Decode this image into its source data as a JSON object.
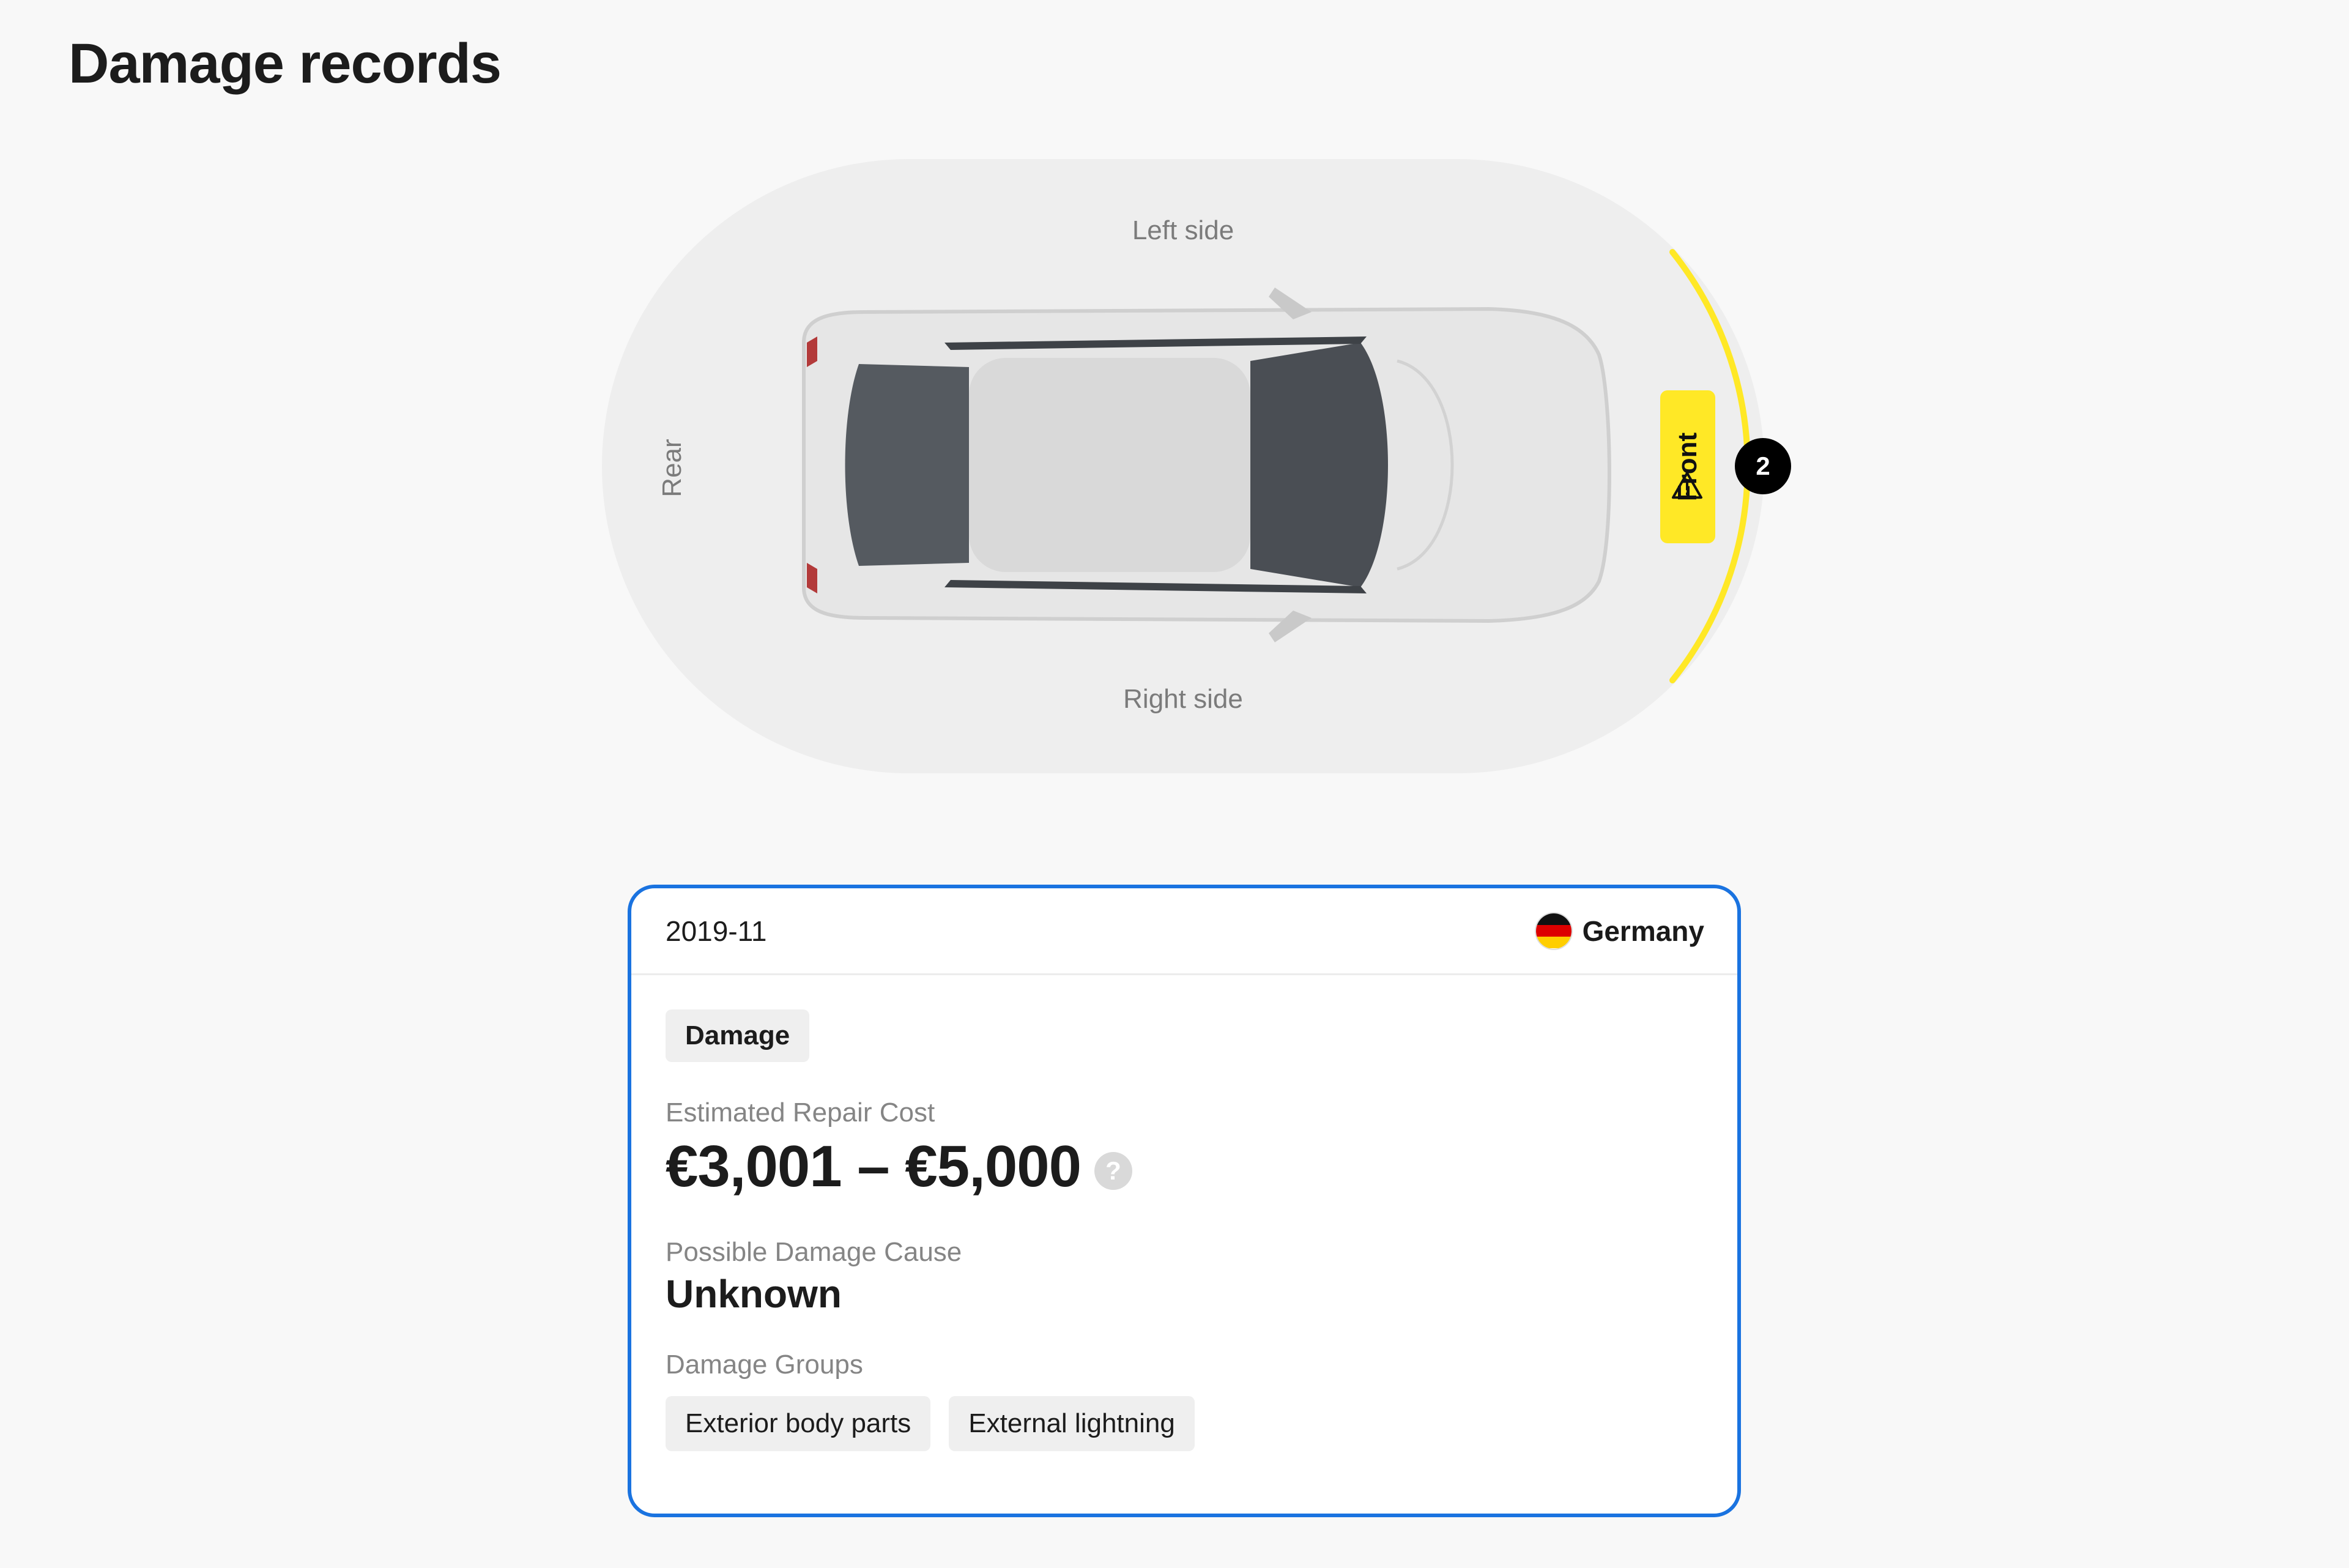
{
  "page": {
    "title": "Damage records"
  },
  "diagram": {
    "labels": {
      "left": "Left side",
      "right": "Right side",
      "rear": "Rear",
      "front": "Front"
    },
    "front_damage_count": "2",
    "highlight_color": "#ffe826",
    "warning_icon": "warning-triangle-icon"
  },
  "record": {
    "date": "2019-11",
    "country": "Germany",
    "flag_icon": "germany-flag-icon",
    "type_tag": "Damage",
    "cost_label": "Estimated Repair Cost",
    "cost_value": "€3,001 – €5,000",
    "help_icon": "?",
    "cause_label": "Possible Damage Cause",
    "cause_value": "Unknown",
    "groups_label": "Damage Groups",
    "groups": [
      "Exterior body parts",
      "External lightning"
    ],
    "accent_color": "#1a73e0"
  }
}
